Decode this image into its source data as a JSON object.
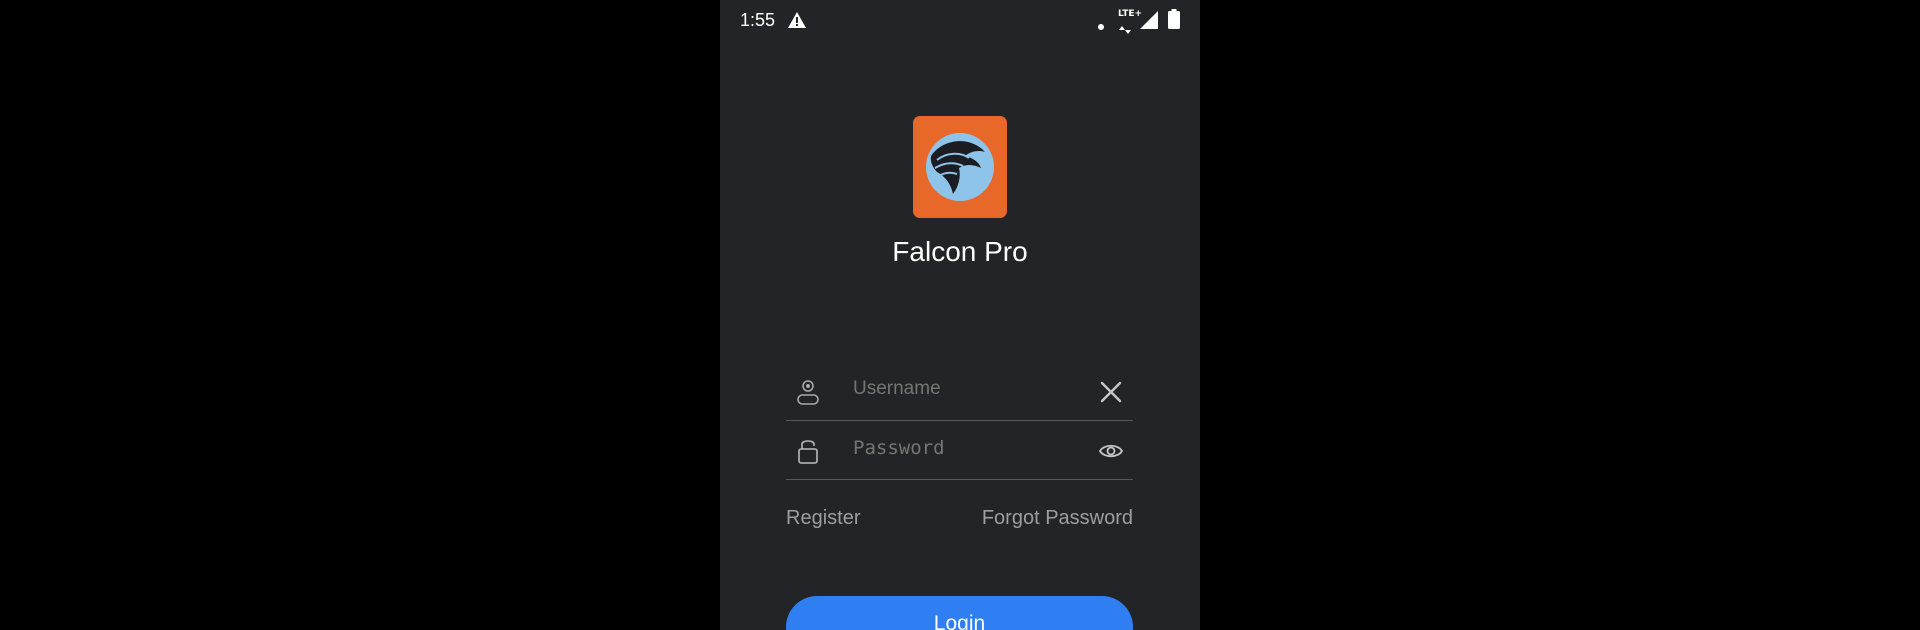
{
  "status_bar": {
    "time": "1:55",
    "network_label": "LTE+",
    "icons": [
      "warning-icon",
      "notification-dot-icon",
      "lte-icon",
      "signal-icon",
      "battery-icon"
    ]
  },
  "app": {
    "name": "Falcon Pro",
    "logo_icon": "falcon-logo-icon",
    "brand_color": "#e8682a",
    "logo_circle_color": "#8ec4ea"
  },
  "login_form": {
    "username": {
      "placeholder": "Username",
      "value": "",
      "leading_icon": "user-icon",
      "trailing_icon": "clear-icon"
    },
    "password": {
      "placeholder": "Password",
      "value": "",
      "leading_icon": "lock-icon",
      "trailing_icon": "eye-icon"
    },
    "register_label": "Register",
    "forgot_password_label": "Forgot Password",
    "login_label": "Login"
  },
  "colors": {
    "background": "#232427",
    "accent": "#2f7ff3",
    "muted_text": "#9c9ea2"
  }
}
